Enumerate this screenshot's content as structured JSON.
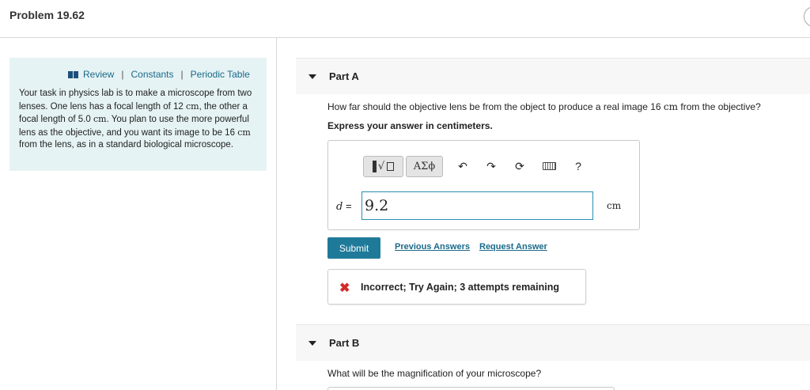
{
  "header": {
    "title": "Problem 19.62"
  },
  "sidebar": {
    "links": [
      "Review",
      "Constants",
      "Periodic Table"
    ],
    "separator": "|",
    "intro": {
      "p1": "Your task in physics lab is to make a microscope from two lenses. One lens has a focal length of 12",
      "u1": "cm",
      "p2": ", the other a focal length of 5.0",
      "u2": "cm",
      "p3": ". You plan to use the more powerful lens as the objective, and you want its image to be 16",
      "u3": "cm",
      "p4": "from the lens, as in a standard biological microscope."
    }
  },
  "part_a": {
    "label": "Part A",
    "question_pre": "How far should the objective lens be from the object to produce a real image 16",
    "question_unit": "cm",
    "question_post": "from the objective?",
    "instruction": "Express your answer in centimeters.",
    "toolbar": {
      "greek_label": "ΑΣϕ",
      "help_label": "?"
    },
    "variable": "d",
    "equals": "=",
    "answer_value": "9.2",
    "unit": "cm",
    "submit_label": "Submit",
    "previous_answers_label": "Previous Answers",
    "request_answer_label": "Request Answer",
    "feedback": {
      "icon": "✖",
      "text": "Incorrect; Try Again; 3 attempts remaining"
    }
  },
  "part_b": {
    "label": "Part B",
    "question": "What will be the magnification of your microscope?"
  },
  "colors": {
    "link": "#1a6a8a",
    "submit_bg": "#1f7a99",
    "error": "#d12b2b",
    "panel_bg": "#e6f3f4"
  }
}
